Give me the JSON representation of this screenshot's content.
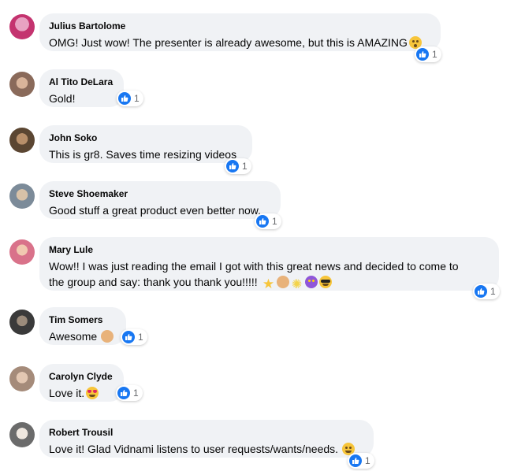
{
  "comments": [
    {
      "name": "Julius Bartolome",
      "text": "OMG! Just wow! The presenter is already awesome, but this is AMAZING",
      "likes": "1",
      "avatar_color": "#c4336f"
    },
    {
      "name": "Al Tito DeLara",
      "text": "Gold!",
      "likes": "1",
      "avatar_color": "#8a6a5a"
    },
    {
      "name": "John Soko",
      "text": "This is gr8. Saves time resizing videos",
      "likes": "1",
      "avatar_color": "#5b4632"
    },
    {
      "name": "Steve Shoemaker",
      "text": "Good stuff a great product even better now.",
      "likes": "1",
      "avatar_color": "#7c8b99"
    },
    {
      "name": "Mary Lule",
      "text_line1": "Wow!! I was just reading the email I got with this great news and decided to come to",
      "text_line2": "the group and say: thank you thank you!!!!!",
      "likes": "1",
      "avatar_color": "#d9728a"
    },
    {
      "name": "Tim Somers",
      "text": "Awesome",
      "likes": "1",
      "avatar_color": "#3a3a3a"
    },
    {
      "name": "Carolyn Clyde",
      "text": "Love it.",
      "likes": "1",
      "avatar_color": "#a58b7a"
    },
    {
      "name": "Robert Trousil",
      "text": "Love it! Glad Vidnami listens to user requests/wants/needs.",
      "likes": "1",
      "avatar_color": "#6b6b6b"
    }
  ],
  "colors": {
    "bubble": "#f0f2f5",
    "like_blue": "#1877f2",
    "count_gray": "#65676b"
  },
  "icons": {
    "reaction": "like-icon"
  }
}
